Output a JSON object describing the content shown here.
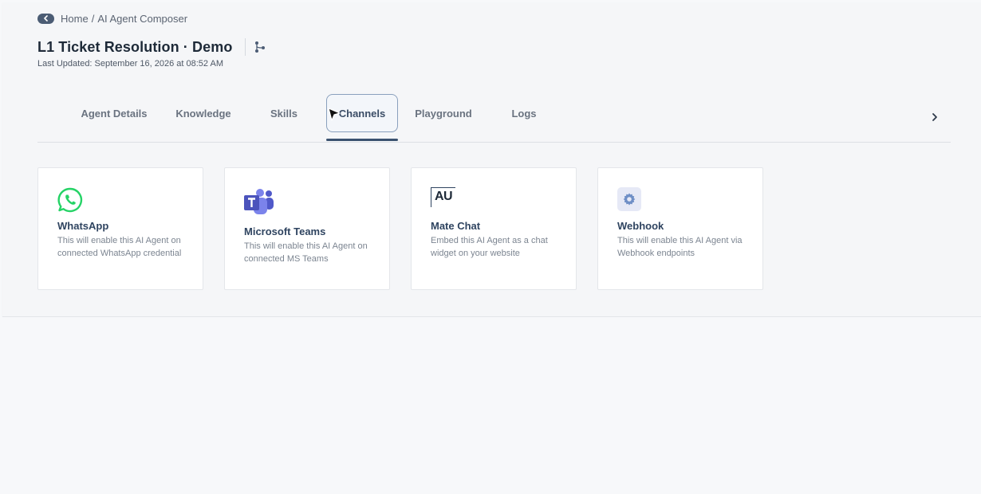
{
  "breadcrumb": {
    "home": "Home",
    "separator": "/",
    "current": "AI Agent Composer"
  },
  "header": {
    "title": "L1 Ticket Resolution · Demo",
    "last_updated": "Last Updated: September 16, 2026 at 08:52 AM"
  },
  "tabs": [
    {
      "label": "Agent Details",
      "active": false
    },
    {
      "label": "Knowledge",
      "active": false
    },
    {
      "label": "Skills",
      "active": false
    },
    {
      "label": "Channels",
      "active": true
    },
    {
      "label": "Playground",
      "active": false
    },
    {
      "label": "Logs",
      "active": false
    }
  ],
  "channels": [
    {
      "name": "WhatsApp",
      "description": "This will enable this AI Agent on connected WhatsApp credential",
      "icon": "whatsapp-icon"
    },
    {
      "name": "Microsoft Teams",
      "description": "This will enable this AI Agent on connected MS Teams",
      "icon": "microsoft-teams-icon"
    },
    {
      "name": "Mate Chat",
      "description": "Embed this AI Agent as a chat widget on your website",
      "icon": "mate-chat-icon",
      "icon_text": "AU"
    },
    {
      "name": "Webhook",
      "description": "This will enable this AI Agent via Webhook endpoints",
      "icon": "webhook-gear-icon"
    }
  ],
  "colors": {
    "accent": "#3b5270",
    "whatsapp": "#25d366",
    "teams": "#5059c9"
  }
}
